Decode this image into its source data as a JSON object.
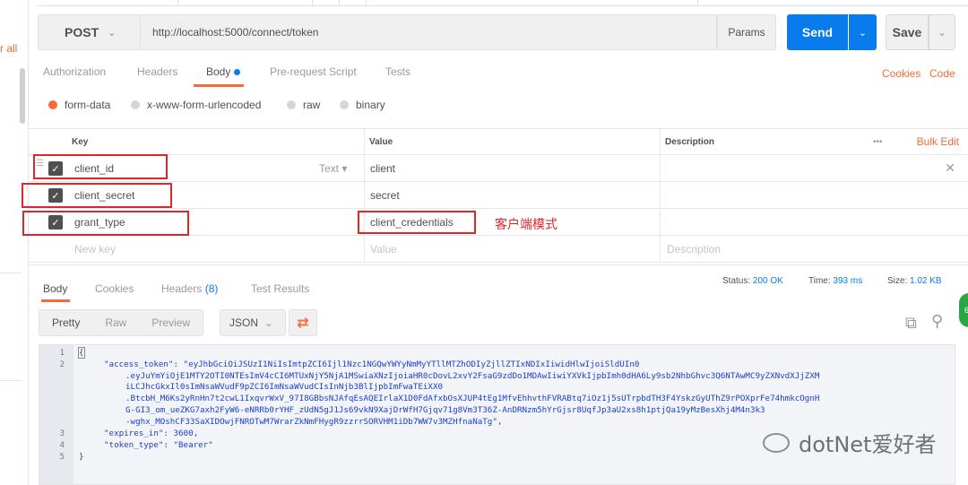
{
  "sidebar": {
    "clear_all_label": "r all"
  },
  "request": {
    "method": "POST",
    "url": "http://localhost:5000/connect/token",
    "params_label": "Params",
    "send_label": "Send",
    "save_label": "Save"
  },
  "req_tabs": {
    "authorization": "Authorization",
    "headers": "Headers",
    "body": "Body",
    "prerequest": "Pre-request Script",
    "tests": "Tests",
    "cookies": "Cookies",
    "code": "Code"
  },
  "body_types": {
    "form_data": "form-data",
    "urlencoded": "x-www-form-urlencoded",
    "raw": "raw",
    "binary": "binary"
  },
  "kv": {
    "head_key": "Key",
    "head_value": "Value",
    "head_description": "Description",
    "bulk_edit": "Bulk Edit",
    "type_label": "Text",
    "rows": [
      {
        "key": "client_id",
        "value": "client"
      },
      {
        "key": "client_secret",
        "value": "secret"
      },
      {
        "key": "grant_type",
        "value": "client_credentials"
      }
    ],
    "new_key_placeholder": "New key",
    "value_placeholder": "Value",
    "description_placeholder": "Description",
    "annotation": "客户端模式"
  },
  "response": {
    "tabs": {
      "body": "Body",
      "cookies": "Cookies",
      "headers": "Headers",
      "headers_count": "(8)",
      "test_results": "Test Results"
    },
    "status_label": "Status:",
    "status_value": "200 OK",
    "time_label": "Time:",
    "time_value": "393 ms",
    "size_label": "Size:",
    "size_value": "1.02 KB",
    "view_pretty": "Pretty",
    "view_raw": "Raw",
    "view_preview": "Preview",
    "format": "JSON",
    "code_lines": [
      {
        "n": "1",
        "text": "{"
      },
      {
        "n": "2",
        "key": "\"access_token\"",
        "val": "\"eyJhbGciOiJSUzI1NiIsImtpZCI6Ijl1Nzc1NGQwYWYyNmMyYTllMTZhODIyZjllZTIxNDIxIiwidHlwIjoiSldUIn0"
      },
      {
        "n": "",
        "cont": ".eyJuYmYiOjE1MTY2OTI0NTEsImV4cCI6MTUxNjY5NjA1MSwiaXNzIjoiaHR0cDovL2xvY2FsaG9zdDo1MDAwIiwiYXVkIjpbImh0dHA6Ly9sb2NhbGhvc3Q6NTAwMC9yZXNvdXJjZXM"
      },
      {
        "n": "",
        "cont": "iLCJhcGkxIl0sImNsaWVudF9pZCI6ImNsaWVudCIsInNjb3BlIjpbImFwaTEiXX0"
      },
      {
        "n": "",
        "cont": ".BtcbH_M6Ks2yRnHn7t2cwL1IxqvrWxV_97I8GBbsNJAfqEsAQEIrlaX1D0FdAfxbOsXJUP4tEg1MfvEhhvthFVRABtq7iOz1j5sUTrpbdTH3F4YskzGyUThZ9rPOXprFe74hmkcOgnH"
      },
      {
        "n": "",
        "cont": "G-GI3_om_ueZKG7axh2FyW6-eNRRb0rYHF_zUdN5gJ1Js69vkN9XajDrWfH7Gjqv71g8Vm3T36Z-AnDRNzm5hYrGjsr8UqfJp3aU2xs8h1ptjQa19yMzBesXhj4M4n3k3"
      },
      {
        "n": "",
        "cont": "-wghx_MOshCF33SaXIDOwjFNROTwM7WrarZkNmFHygR9zzrrSORVHM1iDb7WW7v3MZHfnaNaTg\","
      },
      {
        "n": "3",
        "key": "\"expires_in\"",
        "num": "3600,"
      },
      {
        "n": "4",
        "key": "\"token_type\"",
        "val": "\"Bearer\""
      },
      {
        "n": "5",
        "text": "}"
      }
    ]
  },
  "watermark": "dotNet爱好者",
  "icons": [
    "chevron-down-icon",
    "copy-icon",
    "search-icon",
    "wrap-icon",
    "drag-handle-icon",
    "close-icon",
    "checkbox-icon"
  ],
  "colors": {
    "accent": "#f26b3a",
    "primary": "#097bed",
    "annotation": "#e0262b"
  }
}
